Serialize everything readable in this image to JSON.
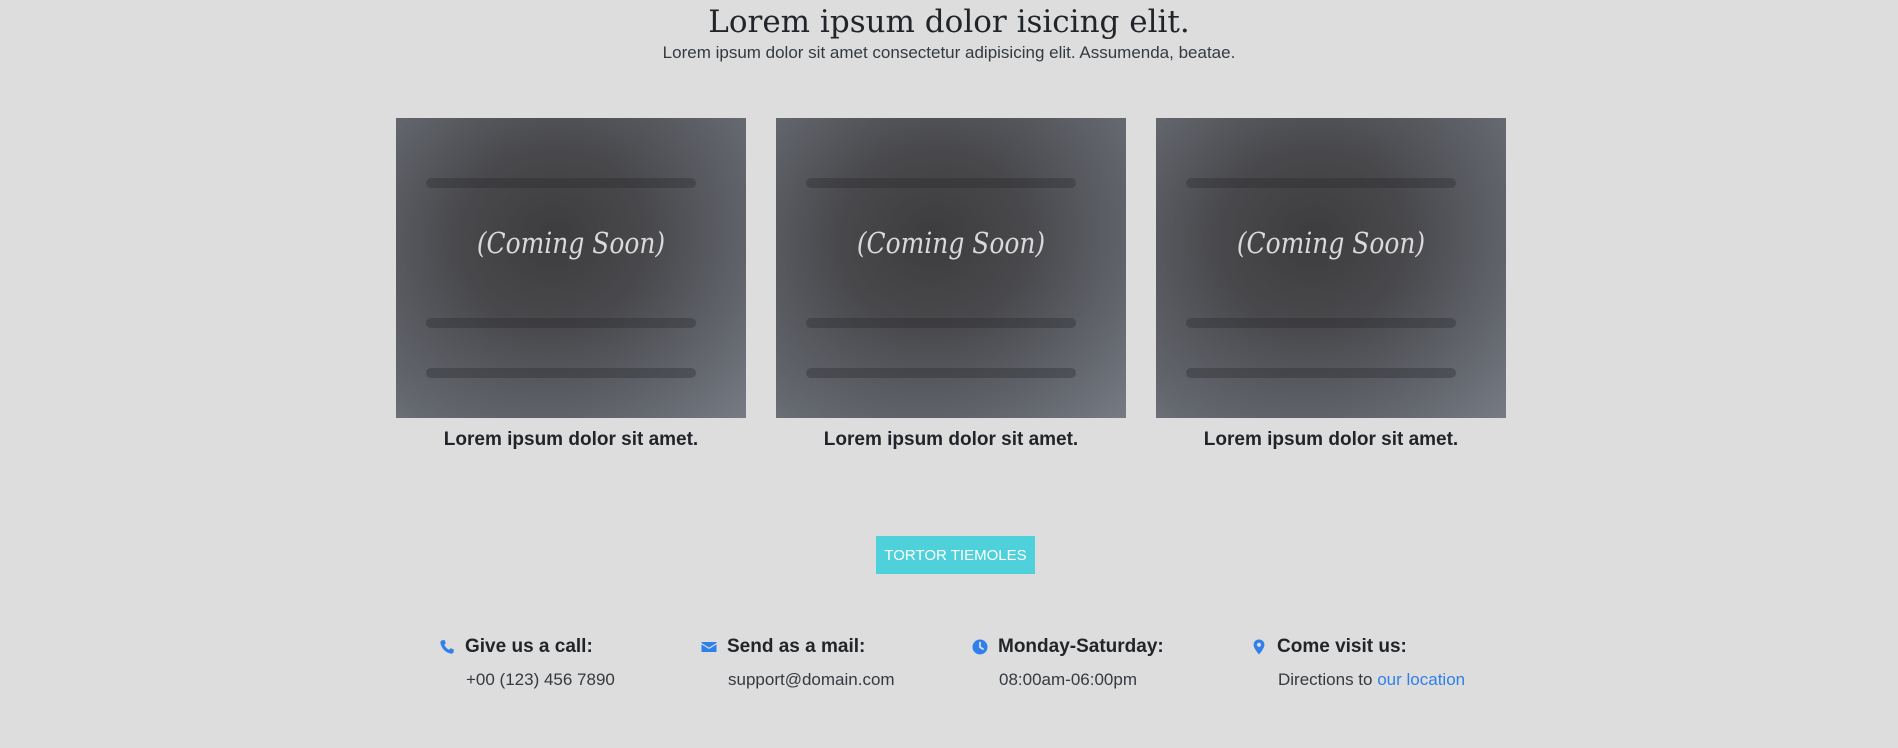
{
  "header": {
    "title": "Lorem ipsum dolor isicing elit.",
    "subtitle": "Lorem ipsum dolor sit amet consectetur adipisicing elit. Assumenda, beatae."
  },
  "cards": [
    {
      "image_text": "(Coming Soon)",
      "caption": "Lorem ipsum dolor sit amet."
    },
    {
      "image_text": "(Coming Soon)",
      "caption": "Lorem ipsum dolor sit amet."
    },
    {
      "image_text": "(Coming Soon)",
      "caption": "Lorem ipsum dolor sit amet."
    }
  ],
  "cta": {
    "label": "TORTOR TIEMOLES"
  },
  "contacts": {
    "call": {
      "icon": "phone-icon",
      "label": "Give us a call:",
      "value": "+00 (123) 456 7890"
    },
    "mail": {
      "icon": "envelope-icon",
      "label": "Send as a mail:",
      "value": "support@domain.com"
    },
    "hours": {
      "icon": "clock-icon",
      "label": "Monday-Saturday:",
      "value": "08:00am-06:00pm"
    },
    "visit": {
      "icon": "map-pin-icon",
      "label": "Come visit us:",
      "value_prefix": "Directions to",
      "link_text": "our location"
    }
  },
  "colors": {
    "background": "#dddddd",
    "accent": "#2f80ed",
    "button": "#4fd1db"
  }
}
